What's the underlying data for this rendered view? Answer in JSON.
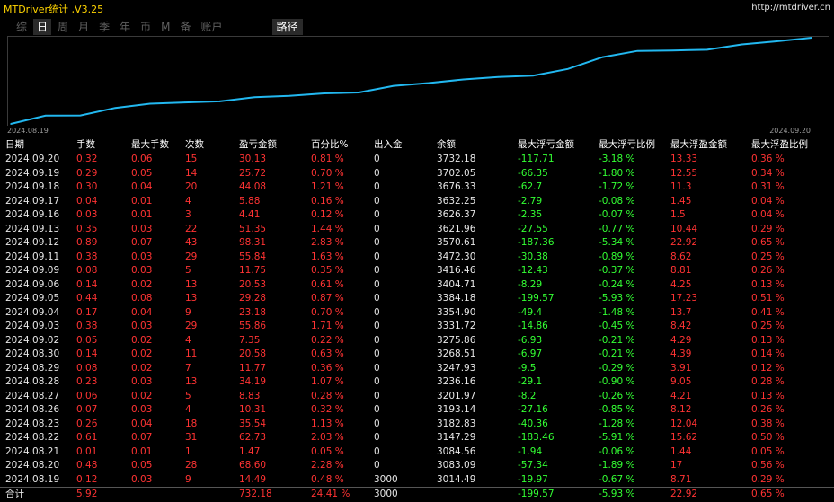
{
  "app": {
    "title": "MTDriver统计 ,V3.25",
    "link": "http://mtdriver.cn"
  },
  "tabs": [
    {
      "label": "综",
      "active": false
    },
    {
      "label": "日",
      "active": true
    },
    {
      "label": "周",
      "active": false
    },
    {
      "label": "月",
      "active": false
    },
    {
      "label": "季",
      "active": false
    },
    {
      "label": "年",
      "active": false
    },
    {
      "label": "币",
      "active": false
    },
    {
      "label": "M",
      "active": false
    },
    {
      "label": "备",
      "active": false
    },
    {
      "label": "账户",
      "active": false
    }
  ],
  "route_tab": "路径",
  "colors": {
    "line": "#22b8f0",
    "profit": "#ff3333",
    "loss": "#33ff33",
    "text": "#e6e6e6"
  },
  "chart_data": {
    "type": "line",
    "x_start_label": "2024.08.19",
    "x_end_label": "2024.09.20",
    "x": [
      "2024.08.19",
      "2024.08.20",
      "2024.08.21",
      "2024.08.22",
      "2024.08.23",
      "2024.08.26",
      "2024.08.27",
      "2024.08.28",
      "2024.08.29",
      "2024.08.30",
      "2024.09.02",
      "2024.09.03",
      "2024.09.04",
      "2024.09.05",
      "2024.09.06",
      "2024.09.09",
      "2024.09.11",
      "2024.09.12",
      "2024.09.13",
      "2024.09.16",
      "2024.09.17",
      "2024.09.18",
      "2024.09.19",
      "2024.09.20"
    ],
    "values": [
      3014.49,
      3083.09,
      3084.56,
      3147.29,
      3182.83,
      3193.14,
      3201.97,
      3236.16,
      3247.93,
      3268.51,
      3275.86,
      3331.72,
      3354.9,
      3384.18,
      3404.71,
      3416.46,
      3472.3,
      3570.61,
      3621.96,
      3626.37,
      3632.25,
      3676.33,
      3702.05,
      3732.18
    ],
    "grid": false
  },
  "headers": [
    "日期",
    "手数",
    "最大手数",
    "次数",
    "盈亏金额",
    "百分比%",
    "出入金",
    "余额",
    "最大浮亏金额",
    "最大浮亏比例",
    "最大浮盈金额",
    "最大浮盈比例"
  ],
  "rows": [
    [
      "2024.09.20",
      "0.32",
      "0.06",
      "15",
      "30.13",
      "0.81 %",
      "0",
      "3732.18",
      "-117.71",
      "-3.18 %",
      "13.33",
      "0.36 %"
    ],
    [
      "2024.09.19",
      "0.29",
      "0.05",
      "14",
      "25.72",
      "0.70 %",
      "0",
      "3702.05",
      "-66.35",
      "-1.80 %",
      "12.55",
      "0.34 %"
    ],
    [
      "2024.09.18",
      "0.30",
      "0.04",
      "20",
      "44.08",
      "1.21 %",
      "0",
      "3676.33",
      "-62.7",
      "-1.72 %",
      "11.3",
      "0.31 %"
    ],
    [
      "2024.09.17",
      "0.04",
      "0.01",
      "4",
      "5.88",
      "0.16 %",
      "0",
      "3632.25",
      "-2.79",
      "-0.08 %",
      "1.45",
      "0.04 %"
    ],
    [
      "2024.09.16",
      "0.03",
      "0.01",
      "3",
      "4.41",
      "0.12 %",
      "0",
      "3626.37",
      "-2.35",
      "-0.07 %",
      "1.5",
      "0.04 %"
    ],
    [
      "2024.09.13",
      "0.35",
      "0.03",
      "22",
      "51.35",
      "1.44 %",
      "0",
      "3621.96",
      "-27.55",
      "-0.77 %",
      "10.44",
      "0.29 %"
    ],
    [
      "2024.09.12",
      "0.89",
      "0.07",
      "43",
      "98.31",
      "2.83 %",
      "0",
      "3570.61",
      "-187.36",
      "-5.34 %",
      "22.92",
      "0.65 %"
    ],
    [
      "2024.09.11",
      "0.38",
      "0.03",
      "29",
      "55.84",
      "1.63 %",
      "0",
      "3472.30",
      "-30.38",
      "-0.89 %",
      "8.62",
      "0.25 %"
    ],
    [
      "2024.09.09",
      "0.08",
      "0.03",
      "5",
      "11.75",
      "0.35 %",
      "0",
      "3416.46",
      "-12.43",
      "-0.37 %",
      "8.81",
      "0.26 %"
    ],
    [
      "2024.09.06",
      "0.14",
      "0.02",
      "13",
      "20.53",
      "0.61 %",
      "0",
      "3404.71",
      "-8.29",
      "-0.24 %",
      "4.25",
      "0.13 %"
    ],
    [
      "2024.09.05",
      "0.44",
      "0.08",
      "13",
      "29.28",
      "0.87 %",
      "0",
      "3384.18",
      "-199.57",
      "-5.93 %",
      "17.23",
      "0.51 %"
    ],
    [
      "2024.09.04",
      "0.17",
      "0.04",
      "9",
      "23.18",
      "0.70 %",
      "0",
      "3354.90",
      "-49.4",
      "-1.48 %",
      "13.7",
      "0.41 %"
    ],
    [
      "2024.09.03",
      "0.38",
      "0.03",
      "29",
      "55.86",
      "1.71 %",
      "0",
      "3331.72",
      "-14.86",
      "-0.45 %",
      "8.42",
      "0.25 %"
    ],
    [
      "2024.09.02",
      "0.05",
      "0.02",
      "4",
      "7.35",
      "0.22 %",
      "0",
      "3275.86",
      "-6.93",
      "-0.21 %",
      "4.29",
      "0.13 %"
    ],
    [
      "2024.08.30",
      "0.14",
      "0.02",
      "11",
      "20.58",
      "0.63 %",
      "0",
      "3268.51",
      "-6.97",
      "-0.21 %",
      "4.39",
      "0.14 %"
    ],
    [
      "2024.08.29",
      "0.08",
      "0.02",
      "7",
      "11.77",
      "0.36 %",
      "0",
      "3247.93",
      "-9.5",
      "-0.29 %",
      "3.91",
      "0.12 %"
    ],
    [
      "2024.08.28",
      "0.23",
      "0.03",
      "13",
      "34.19",
      "1.07 %",
      "0",
      "3236.16",
      "-29.1",
      "-0.90 %",
      "9.05",
      "0.28 %"
    ],
    [
      "2024.08.27",
      "0.06",
      "0.02",
      "5",
      "8.83",
      "0.28 %",
      "0",
      "3201.97",
      "-8.2",
      "-0.26 %",
      "4.21",
      "0.13 %"
    ],
    [
      "2024.08.26",
      "0.07",
      "0.03",
      "4",
      "10.31",
      "0.32 %",
      "0",
      "3193.14",
      "-27.16",
      "-0.85 %",
      "8.12",
      "0.26 %"
    ],
    [
      "2024.08.23",
      "0.26",
      "0.04",
      "18",
      "35.54",
      "1.13 %",
      "0",
      "3182.83",
      "-40.36",
      "-1.28 %",
      "12.04",
      "0.38 %"
    ],
    [
      "2024.08.22",
      "0.61",
      "0.07",
      "31",
      "62.73",
      "2.03 %",
      "0",
      "3147.29",
      "-183.46",
      "-5.91 %",
      "15.62",
      "0.50 %"
    ],
    [
      "2024.08.21",
      "0.01",
      "0.01",
      "1",
      "1.47",
      "0.05 %",
      "0",
      "3084.56",
      "-1.94",
      "-0.06 %",
      "1.44",
      "0.05 %"
    ],
    [
      "2024.08.20",
      "0.48",
      "0.05",
      "28",
      "68.60",
      "2.28 %",
      "0",
      "3083.09",
      "-57.34",
      "-1.89 %",
      "17",
      "0.56 %"
    ],
    [
      "2024.08.19",
      "0.12",
      "0.03",
      "9",
      "14.49",
      "0.48 %",
      "3000",
      "3014.49",
      "-19.97",
      "-0.67 %",
      "8.71",
      "0.29 %"
    ]
  ],
  "total": [
    "合计",
    "5.92",
    "",
    "",
    "732.18",
    "24.41 %",
    "3000",
    "",
    "-199.57",
    "-5.93 %",
    "22.92",
    "0.65 %"
  ]
}
